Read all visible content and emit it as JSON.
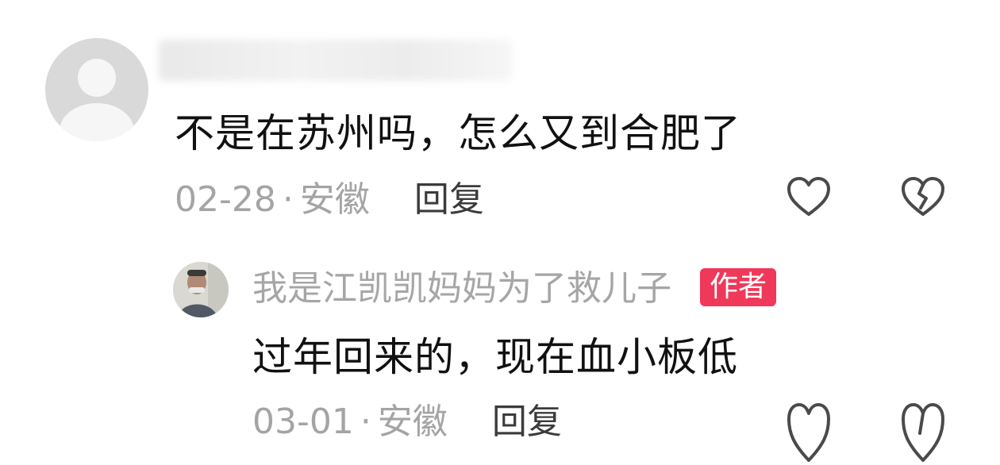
{
  "comment": {
    "text": "不是在苏州吗，怎么又到合肥了",
    "date": "02-28",
    "separator": "·",
    "location": "安徽",
    "reply_label": "回复"
  },
  "reply": {
    "username": "我是江凯凯妈妈为了救儿子",
    "badge": "作者",
    "text": "过年回来的，现在血小板低",
    "date": "03-01",
    "separator": "·",
    "location": "安徽",
    "reply_label": "回复"
  },
  "icons": {
    "like": "heart-outline-icon",
    "dislike": "broken-heart-icon",
    "accent": "#f0385a"
  }
}
